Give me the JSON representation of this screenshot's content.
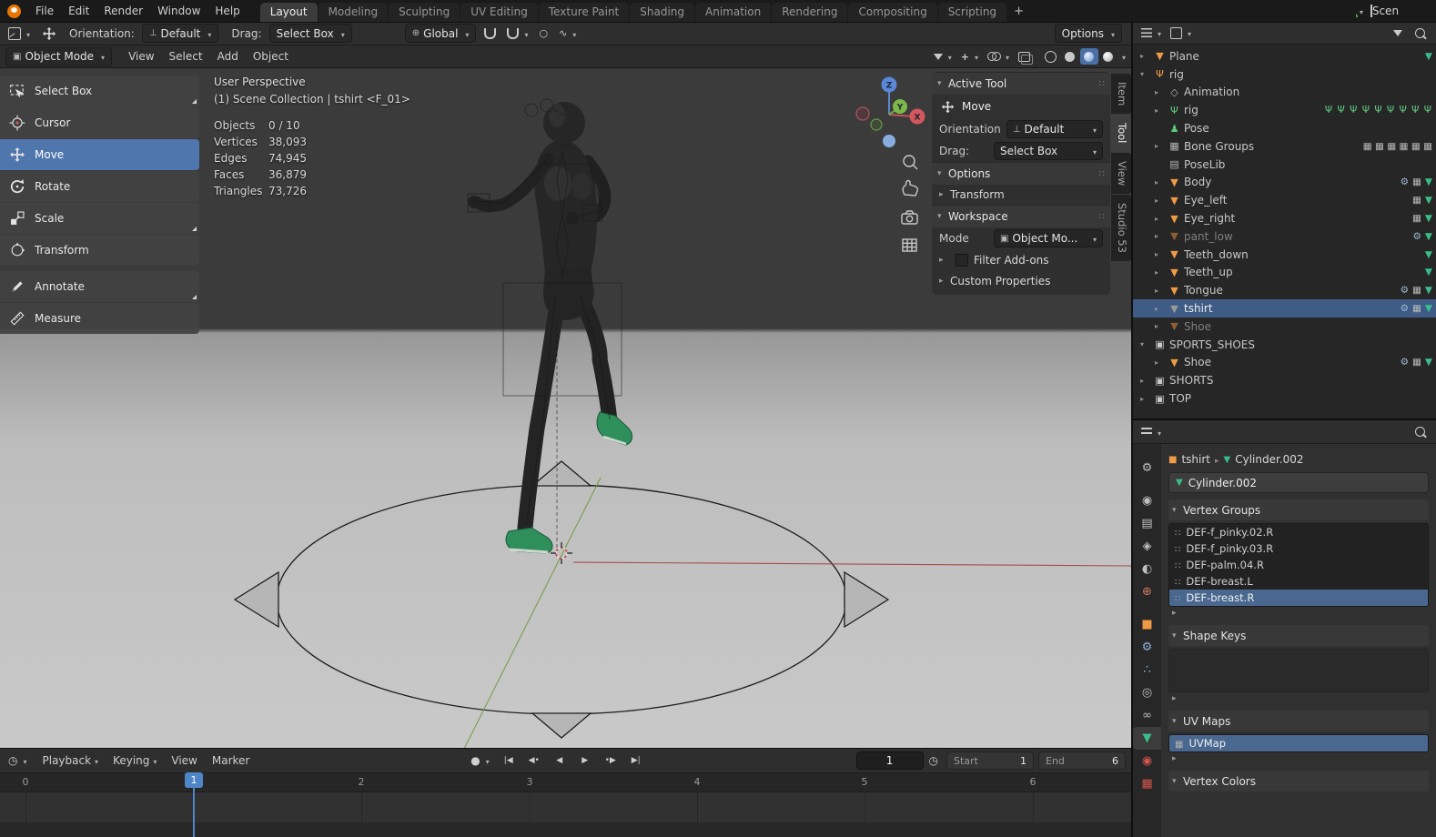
{
  "topbar": {
    "menus": [
      "File",
      "Edit",
      "Render",
      "Window",
      "Help"
    ],
    "tabs": [
      {
        "label": "Layout",
        "active": true
      },
      {
        "label": "Modeling"
      },
      {
        "label": "Sculpting"
      },
      {
        "label": "UV Editing"
      },
      {
        "label": "Texture Paint"
      },
      {
        "label": "Shading"
      },
      {
        "label": "Animation"
      },
      {
        "label": "Rendering"
      },
      {
        "label": "Compositing"
      },
      {
        "label": "Scripting"
      }
    ],
    "new_tab": "+",
    "scene": "Scen"
  },
  "tool_settings": {
    "orientation_label": "Orientation:",
    "orientation_value": "Default",
    "drag_label": "Drag:",
    "drag_value": "Select Box",
    "pivot_value": "Global",
    "options_label": "Options"
  },
  "viewport_header": {
    "mode": "Object Mode",
    "menus": [
      "View",
      "Select",
      "Add",
      "Object"
    ]
  },
  "toolshelf": [
    {
      "label": "Select Box"
    },
    {
      "label": "Cursor"
    },
    {
      "label": "Move",
      "active": true
    },
    {
      "label": "Rotate"
    },
    {
      "label": "Scale"
    },
    {
      "label": "Transform"
    },
    {
      "label": "Annotate"
    },
    {
      "label": "Measure"
    }
  ],
  "viewport": {
    "perspective_label": "User Perspective",
    "context_label": "(1) Scene Collection | tshirt <F_01>",
    "stats": [
      {
        "name": "Objects",
        "value": "0 / 10"
      },
      {
        "name": "Vertices",
        "value": "38,093"
      },
      {
        "name": "Edges",
        "value": "74,945"
      },
      {
        "name": "Faces",
        "value": "36,879"
      },
      {
        "name": "Triangles",
        "value": "73,726"
      }
    ],
    "axis": {
      "x": "X",
      "y": "Y",
      "z": "Z"
    }
  },
  "npanel": {
    "tabs": [
      {
        "label": "Item"
      },
      {
        "label": "Tool",
        "active": true
      },
      {
        "label": "View"
      },
      {
        "label": "Studio 53"
      }
    ],
    "active_tool_header": "Active Tool",
    "tool_name": "Move",
    "orientation_label": "Orientation",
    "orientation_value": "Default",
    "drag_label": "Drag:",
    "drag_value": "Select Box",
    "options_header": "Options",
    "transform_header": "Transform",
    "workspace_header": "Workspace",
    "mode_label": "Mode",
    "mode_value": "Object Mo...",
    "filter_addons_label": "Filter Add-ons",
    "custom_properties_header": "Custom Properties"
  },
  "outliner": {
    "rows": [
      {
        "label": "Plane",
        "depth": 1,
        "icon": "mesh",
        "arrow": "▸",
        "dat": true
      },
      {
        "label": "rig",
        "depth": 1,
        "icon": "armature",
        "arrow": "▾"
      },
      {
        "label": "Animation",
        "depth": 2,
        "icon": "animation",
        "arrow": "▸"
      },
      {
        "label": "rig",
        "depth": 2,
        "icon": "armature-data",
        "arrow": "▸",
        "bones": true
      },
      {
        "label": "Pose",
        "depth": 2,
        "icon": "pose",
        "arrow": ""
      },
      {
        "label": "Bone Groups",
        "depth": 2,
        "icon": "bone-groups",
        "arrow": "▸",
        "groups": true
      },
      {
        "label": "PoseLib",
        "depth": 2,
        "icon": "poselib",
        "arrow": ""
      },
      {
        "label": "Body",
        "depth": 2,
        "icon": "mesh",
        "arrow": "▸",
        "mod": true,
        "grp": true,
        "dat": true
      },
      {
        "label": "Eye_left",
        "depth": 2,
        "icon": "mesh",
        "arrow": "▸",
        "grp": true,
        "dat": true
      },
      {
        "label": "Eye_right",
        "depth": 2,
        "icon": "mesh",
        "arrow": "▸",
        "grp": true,
        "dat": true
      },
      {
        "label": "pant_low",
        "depth": 2,
        "icon": "mesh",
        "arrow": "▸",
        "dimmed": true,
        "mod": true,
        "dat": true
      },
      {
        "label": "Teeth_down",
        "depth": 2,
        "icon": "mesh",
        "arrow": "▸",
        "dat": true
      },
      {
        "label": "Teeth_up",
        "depth": 2,
        "icon": "mesh",
        "arrow": "▸",
        "dat": true
      },
      {
        "label": "Tongue",
        "depth": 2,
        "icon": "mesh",
        "arrow": "▸",
        "mod": true,
        "grp": true,
        "dat": true
      },
      {
        "label": "tshirt",
        "depth": 2,
        "icon": "mesh",
        "arrow": "▸",
        "selected": true,
        "ghost": true,
        "mod": true,
        "grp": true,
        "dat": true
      },
      {
        "label": "Shoe",
        "depth": 2,
        "icon": "mesh",
        "arrow": "▸",
        "dimmed": true
      },
      {
        "label": "SPORTS_SHOES",
        "depth": 1,
        "icon": "collection",
        "arrow": "▾"
      },
      {
        "label": "Shoe",
        "depth": 2,
        "icon": "mesh",
        "arrow": "▸",
        "mod": true,
        "grp": true,
        "dat": true
      },
      {
        "label": "SHORTS",
        "depth": 1,
        "icon": "collection",
        "arrow": "▸"
      },
      {
        "label": "TOP",
        "depth": 1,
        "icon": "collection",
        "arrow": "▸"
      }
    ]
  },
  "properties": {
    "breadcrumb_object": "tshirt",
    "breadcrumb_data": "Cylinder.002",
    "name_value": "Cylinder.002",
    "vertex_groups_header": "Vertex Groups",
    "vertex_groups": [
      {
        "label": "DEF-f_pinky.02.R"
      },
      {
        "label": "DEF-f_pinky.03.R"
      },
      {
        "label": "DEF-palm.04.R"
      },
      {
        "label": "DEF-breast.L"
      },
      {
        "label": "DEF-breast.R",
        "selected": true
      }
    ],
    "shape_keys_header": "Shape Keys",
    "uv_maps_header": "UV Maps",
    "uv_maps": [
      {
        "label": "UVMap",
        "selected": true
      }
    ],
    "vertex_colors_header": "Vertex Colors",
    "tabs": [
      {
        "name": "tool-tab"
      },
      {
        "name": "render-tab",
        "gap": true
      },
      {
        "name": "output-tab"
      },
      {
        "name": "view-layer-tab"
      },
      {
        "name": "scene-tab"
      },
      {
        "name": "world-tab"
      },
      {
        "name": "object-tab",
        "gap": true
      },
      {
        "name": "modifiers-tab"
      },
      {
        "name": "particles-tab"
      },
      {
        "name": "physics-tab"
      },
      {
        "name": "constraints-tab"
      },
      {
        "name": "data-tab",
        "active": true
      },
      {
        "name": "material-tab"
      },
      {
        "name": "texture-tab"
      }
    ]
  },
  "timeline": {
    "menus": [
      {
        "label": "Playback",
        "chev": true
      },
      {
        "label": "Keying",
        "chev": true
      },
      {
        "label": "View"
      },
      {
        "label": "Marker"
      }
    ],
    "transport": [
      {
        "name": "jump-to-start-button",
        "glyph": "|◀"
      },
      {
        "name": "prev-keyframe-button",
        "glyph": "◀•"
      },
      {
        "name": "play-reverse-button",
        "glyph": "◀"
      },
      {
        "name": "play-button",
        "glyph": "▶"
      },
      {
        "name": "next-keyframe-button",
        "glyph": "•▶"
      },
      {
        "name": "jump-to-end-button",
        "glyph": "▶|"
      }
    ],
    "current_frame": "1",
    "start_label": "Start",
    "start_value": "1",
    "end_label": "End",
    "end_value": "6",
    "ruler": [
      "0",
      "1",
      "2",
      "3",
      "4",
      "5",
      "6"
    ],
    "playhead_label": "1"
  },
  "colors": {
    "accent": "#4772b3",
    "selection": "#3e5c85",
    "object_orange": "#ef9b45",
    "data_green": "#39bd8a",
    "playhead_blue": "#4e86c8"
  }
}
